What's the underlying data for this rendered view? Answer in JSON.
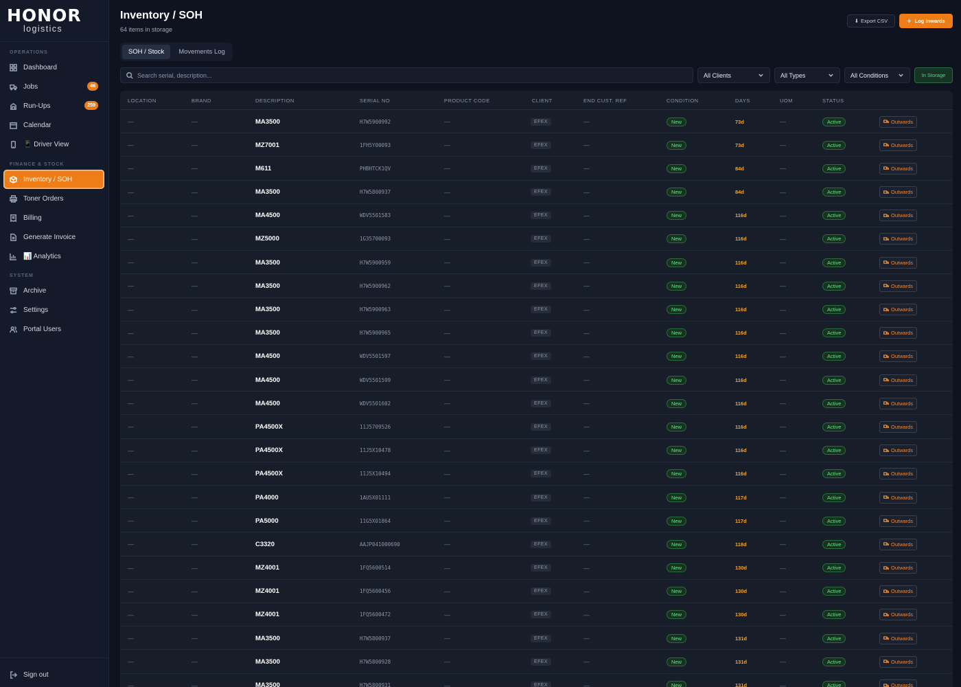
{
  "brand": {
    "logo": "HONOR",
    "sub": "logistics"
  },
  "sidebar": {
    "sections": {
      "operations": "OPERATIONS",
      "finance": "FINANCE & STOCK",
      "system": "SYSTEM"
    },
    "items": [
      {
        "label": "Dashboard",
        "icon": "dashboard-icon"
      },
      {
        "label": "Jobs",
        "icon": "truck-icon",
        "badge": "46"
      },
      {
        "label": "Run-Ups",
        "icon": "building-icon",
        "badge": "259"
      },
      {
        "label": "Calendar",
        "icon": "calendar-icon"
      },
      {
        "label": "📱 Driver View",
        "icon": "phone-icon"
      },
      {
        "label": "Inventory / SOH",
        "icon": "box-icon",
        "active": true
      },
      {
        "label": "Toner Orders",
        "icon": "printer-icon"
      },
      {
        "label": "Billing",
        "icon": "receipt-icon"
      },
      {
        "label": "Generate Invoice",
        "icon": "document-icon"
      },
      {
        "label": "📊 Analytics",
        "icon": "chart-icon"
      },
      {
        "label": "Archive",
        "icon": "archive-icon"
      },
      {
        "label": "Settings",
        "icon": "settings-icon"
      },
      {
        "label": "Portal Users",
        "icon": "users-icon"
      }
    ],
    "signout": "Sign out"
  },
  "header": {
    "title": "Inventory / SOH",
    "subtitle": "64 items in storage",
    "export_label": "Export CSV",
    "log_label": "Log Inwards"
  },
  "tabs": [
    {
      "label": "SOH / Stock",
      "active": true
    },
    {
      "label": "Movements Log",
      "active": false
    }
  ],
  "filters": {
    "search_placeholder": "Search serial, description...",
    "clients": "All Clients",
    "types": "All Types",
    "conditions": "All Conditions",
    "storage_label": "In Storage"
  },
  "table": {
    "columns": [
      "LOCATION",
      "BRAND",
      "DESCRIPTION",
      "SERIAL NO",
      "PRODUCT CODE",
      "CLIENT",
      "END CUST. REF",
      "CONDITION",
      "DAYS",
      "UOM",
      "STATUS"
    ],
    "dash": "—",
    "outwards_label": "Outwards",
    "rows": [
      {
        "description": "MA3500",
        "serial": "H7W5900992",
        "client": "EFEX",
        "condition": "New",
        "days": "73d",
        "status": "Active"
      },
      {
        "description": "MZ7001",
        "serial": "1FH5Y00093",
        "client": "EFEX",
        "condition": "New",
        "days": "73d",
        "status": "Active"
      },
      {
        "description": "M611",
        "serial": "PHBHTCK1QV",
        "client": "EFEX",
        "condition": "New",
        "days": "84d",
        "status": "Active"
      },
      {
        "description": "MA3500",
        "serial": "H7W5800937",
        "client": "EFEX",
        "condition": "New",
        "days": "84d",
        "status": "Active"
      },
      {
        "description": "MA4500",
        "serial": "WDV5501583",
        "client": "EFEX",
        "condition": "New",
        "days": "116d",
        "status": "Active"
      },
      {
        "description": "MZ5000",
        "serial": "1G35700093",
        "client": "EFEX",
        "condition": "New",
        "days": "116d",
        "status": "Active"
      },
      {
        "description": "MA3500",
        "serial": "H7W5900959",
        "client": "EFEX",
        "condition": "New",
        "days": "116d",
        "status": "Active"
      },
      {
        "description": "MA3500",
        "serial": "H7W5900962",
        "client": "EFEX",
        "condition": "New",
        "days": "116d",
        "status": "Active"
      },
      {
        "description": "MA3500",
        "serial": "H7W5900963",
        "client": "EFEX",
        "condition": "New",
        "days": "116d",
        "status": "Active"
      },
      {
        "description": "MA3500",
        "serial": "H7W5900965",
        "client": "EFEX",
        "condition": "New",
        "days": "116d",
        "status": "Active"
      },
      {
        "description": "MA4500",
        "serial": "WDV5501597",
        "client": "EFEX",
        "condition": "New",
        "days": "116d",
        "status": "Active"
      },
      {
        "description": "MA4500",
        "serial": "WDV5501599",
        "client": "EFEX",
        "condition": "New",
        "days": "116d",
        "status": "Active"
      },
      {
        "description": "MA4500",
        "serial": "WDV5501602",
        "client": "EFEX",
        "condition": "New",
        "days": "116d",
        "status": "Active"
      },
      {
        "description": "PA4500X",
        "serial": "11J5709526",
        "client": "EFEX",
        "condition": "New",
        "days": "116d",
        "status": "Active"
      },
      {
        "description": "PA4500X",
        "serial": "11J5X10478",
        "client": "EFEX",
        "condition": "New",
        "days": "116d",
        "status": "Active"
      },
      {
        "description": "PA4500X",
        "serial": "11J5X10494",
        "client": "EFEX",
        "condition": "New",
        "days": "116d",
        "status": "Active"
      },
      {
        "description": "PA4000",
        "serial": "1AU5X01111",
        "client": "EFEX",
        "condition": "New",
        "days": "117d",
        "status": "Active"
      },
      {
        "description": "PA5000",
        "serial": "11G5X01864",
        "client": "EFEX",
        "condition": "New",
        "days": "117d",
        "status": "Active"
      },
      {
        "description": "C3320",
        "serial": "AAJP041000690",
        "client": "EFEX",
        "condition": "New",
        "days": "118d",
        "status": "Active"
      },
      {
        "description": "MZ4001",
        "serial": "1FQ5600514",
        "client": "EFEX",
        "condition": "New",
        "days": "130d",
        "status": "Active"
      },
      {
        "description": "MZ4001",
        "serial": "1FQ5600456",
        "client": "EFEX",
        "condition": "New",
        "days": "130d",
        "status": "Active"
      },
      {
        "description": "MZ4001",
        "serial": "1FQ5600472",
        "client": "EFEX",
        "condition": "New",
        "days": "130d",
        "status": "Active"
      },
      {
        "description": "MA3500",
        "serial": "H7W5800937",
        "client": "EFEX",
        "condition": "New",
        "days": "131d",
        "status": "Active"
      },
      {
        "description": "MA3500",
        "serial": "H7W5800928",
        "client": "EFEX",
        "condition": "New",
        "days": "131d",
        "status": "Active"
      },
      {
        "description": "MA3500",
        "serial": "H7W5800931",
        "client": "EFEX",
        "condition": "New",
        "days": "131d",
        "status": "Active"
      }
    ]
  },
  "colors": {
    "accent": "#ef7d17",
    "success": "#6be08e",
    "warning": "#f2a52b",
    "bg": "#0f1320"
  }
}
